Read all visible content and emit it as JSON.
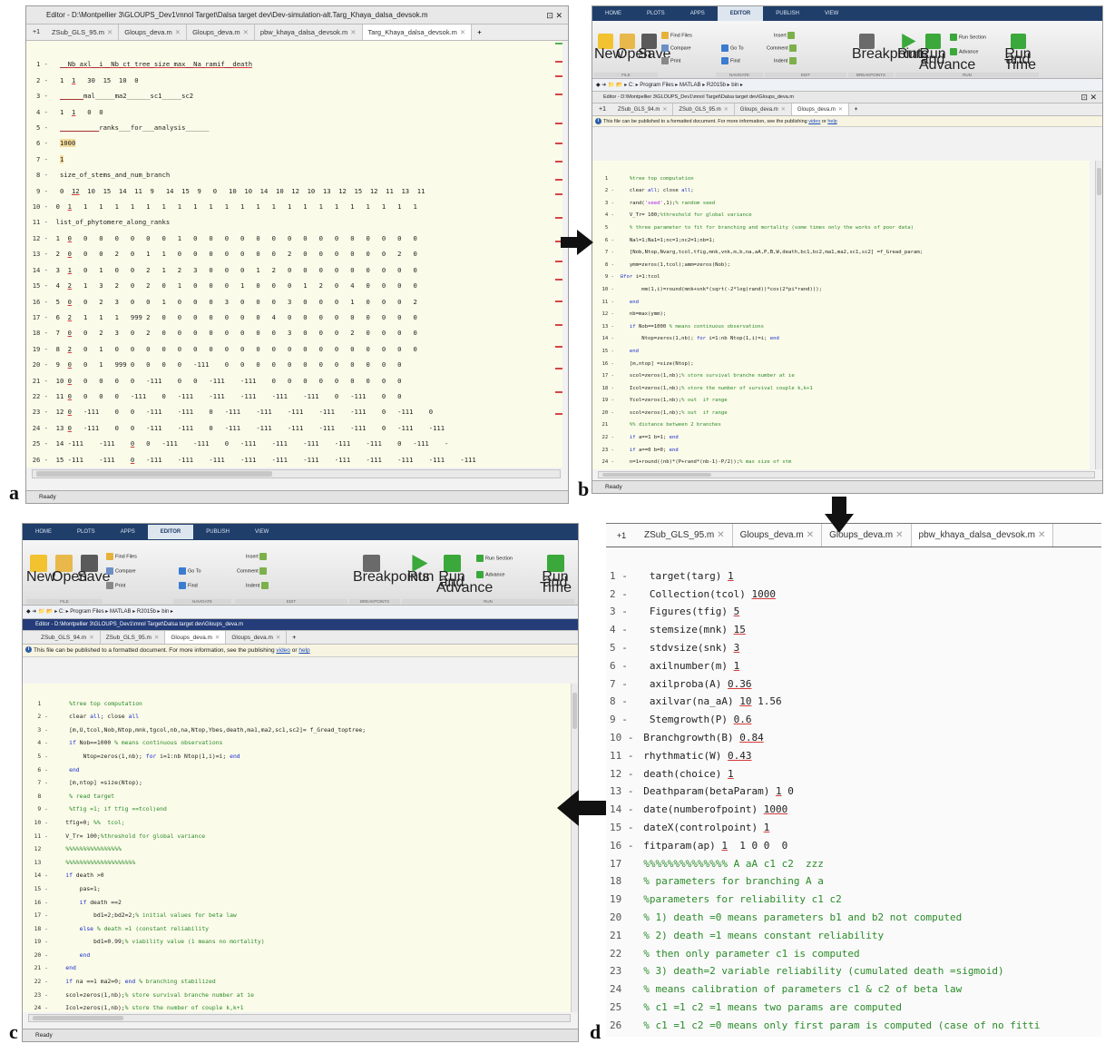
{
  "labels": {
    "a": "a",
    "b": "b",
    "c": "c",
    "d": "d"
  },
  "panel_a": {
    "title": "Editor - D:\\Montpellier 3\\GLOUPS_Dev1\\mnol Target\\Dalsa target dev\\Dev-simulation-alt.Targ_Khaya_dalsa_devsok.m",
    "tabs": [
      "ZSub_GLS_95.m",
      "Gloups_deva.m",
      "Gloups_deva.m",
      "pbw_khaya_dalsa_devsok.m",
      "Targ_Khaya_dalsa_devsok.m"
    ],
    "status": "Ready"
  },
  "panel_b": {
    "ribbon_tabs": [
      "HOME",
      "PLOTS",
      "APPS",
      "EDITOR",
      "PUBLISH",
      "VIEW"
    ],
    "ribbon": {
      "new": "New",
      "open": "Open",
      "save": "Save",
      "find_files": "Find Files",
      "compare": "Compare",
      "print": "Print",
      "insert": "Insert",
      "comment": "Comment",
      "indent": "Indent",
      "go_to": "Go To",
      "find": "Find",
      "breakpoints": "Breakpoints",
      "run": "Run",
      "run_advance": "Run and Advance",
      "run_section": "Run Section",
      "advance": "Advance",
      "run_time": "Run and Time",
      "g_file": "FILE",
      "g_navigate": "NAVIGATE",
      "g_edit": "EDIT",
      "g_breakpoints": "BREAKPOINTS",
      "g_run": "RUN"
    },
    "address": "◆ ➔ 📁 📂 ▸ C: ▸ Program Files ▸ MATLAB ▸ R2015b ▸ bin ▸",
    "title": "Editor - D:\\Montpellier 3\\GLOUPS_Dev1\\mnol Target\\Dalsa target dev\\Gloups_deva.m",
    "tabs": [
      "ZSub_GLS_94.m",
      "ZSub_GLS_95.m",
      "Gloups_deva.m",
      "Gloups_deva.m"
    ],
    "publish": {
      "text": "This file can be published to a formatted document. For more information, see the publishing ",
      "link1": "video",
      "or": " or ",
      "link2": "help"
    },
    "status": "Ready"
  },
  "panel_c": {
    "ribbon_tabs": [
      "HOME",
      "PLOTS",
      "APPS",
      "EDITOR",
      "PUBLISH",
      "VIEW"
    ],
    "ribbon": {
      "new": "New",
      "open": "Open",
      "save": "Save",
      "find_files": "Find Files",
      "compare": "Compare",
      "print": "Print",
      "insert": "Insert",
      "comment": "Comment",
      "indent": "Indent",
      "go_to": "Go To",
      "find": "Find",
      "breakpoints": "Breakpoints",
      "run": "Run",
      "run_advance": "Run and Advance",
      "run_section": "Run Section",
      "advance": "Advance",
      "run_time": "Run and Time",
      "g_file": "FILE",
      "g_navigate": "NAVIGATE",
      "g_edit": "EDIT",
      "g_breakpoints": "BREAKPOINTS",
      "g_run": "RUN"
    },
    "address": "◆ ➔ 📁 📂 ▸ C: ▸ Program Files ▸ MATLAB ▸ R2015b ▸ bin ▸",
    "title": "Editor - D:\\Montpellier 3\\GLOUPS_Dev1\\mnol Target\\Dalsa target dev\\Gloups_deva.m",
    "tabs": [
      "ZSub_GLS_94.m",
      "ZSub_GLS_95.m",
      "Gloups_deva.m",
      "Gloups_deva.m"
    ],
    "publish": {
      "text": "This file can be published to a formatted document. For more information, see the publishing ",
      "link1": "video",
      "or": " or ",
      "link2": "help"
    },
    "status": "Ready"
  },
  "panel_d": {
    "tabs": [
      "ZSub_GLS_95.m",
      "Gloups_deva.m",
      "Gloups_deva.m",
      "pbw_khaya_dalsa_devsok.m"
    ]
  }
}
